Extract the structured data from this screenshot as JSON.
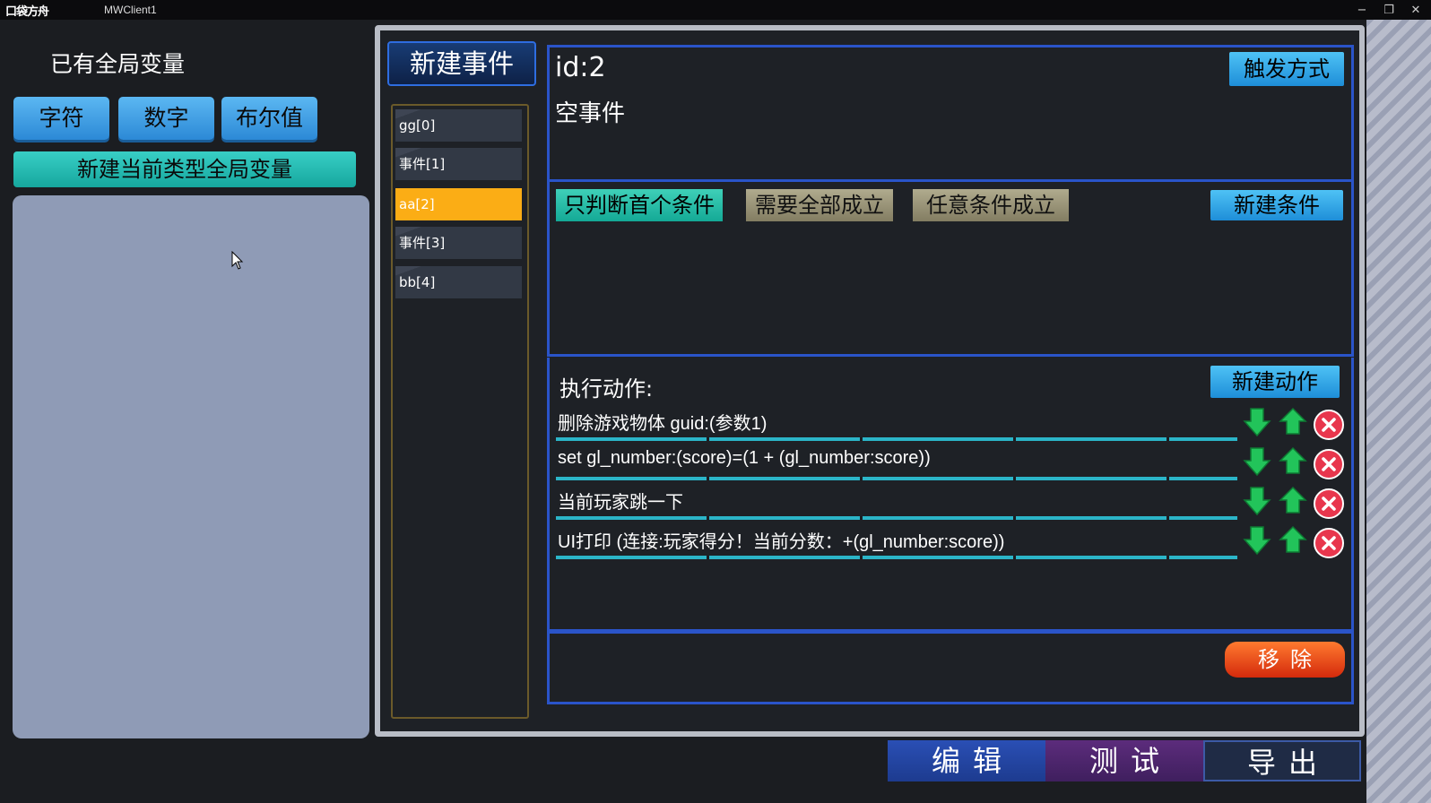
{
  "titlebar": {
    "logo": "口袋方舟",
    "app_name": "MWClient1",
    "minimize": "−",
    "restore": "❐",
    "close": "✕"
  },
  "left": {
    "title": "已有全局变量",
    "type_buttons": [
      "字符",
      "数字",
      "布尔值"
    ],
    "new_global_button": "新建当前类型全局变量"
  },
  "events": {
    "new_event_button": "新建事件",
    "items": [
      "gg[0]",
      "事件[1]",
      "aa[2]",
      "事件[3]",
      "bb[4]"
    ],
    "selected_index": 2
  },
  "detail": {
    "id_label": "id:2",
    "name": "空事件",
    "trigger_button": "触发方式",
    "condition_modes": [
      "只判断首个条件",
      "需要全部成立",
      "任意条件成立"
    ],
    "new_condition_button": "新建条件",
    "actions_title": "执行动作:",
    "new_action_button": "新建动作",
    "actions": [
      "删除游戏物体 guid:(参数1)",
      "set gl_number:(score)=(1 + (gl_number:score))",
      "当前玩家跳一下",
      "UI打印 (连接:玩家得分！当前分数：+(gl_number:score))"
    ],
    "remove_button": "移除"
  },
  "bottom_nav": {
    "edit": "编辑",
    "test": "测试",
    "export": "导出"
  },
  "colors": {
    "accent_blue": "#2e6de0",
    "selected_event": "#fbad15",
    "condition_active": "#14a996",
    "remove": "#d42a0c"
  }
}
